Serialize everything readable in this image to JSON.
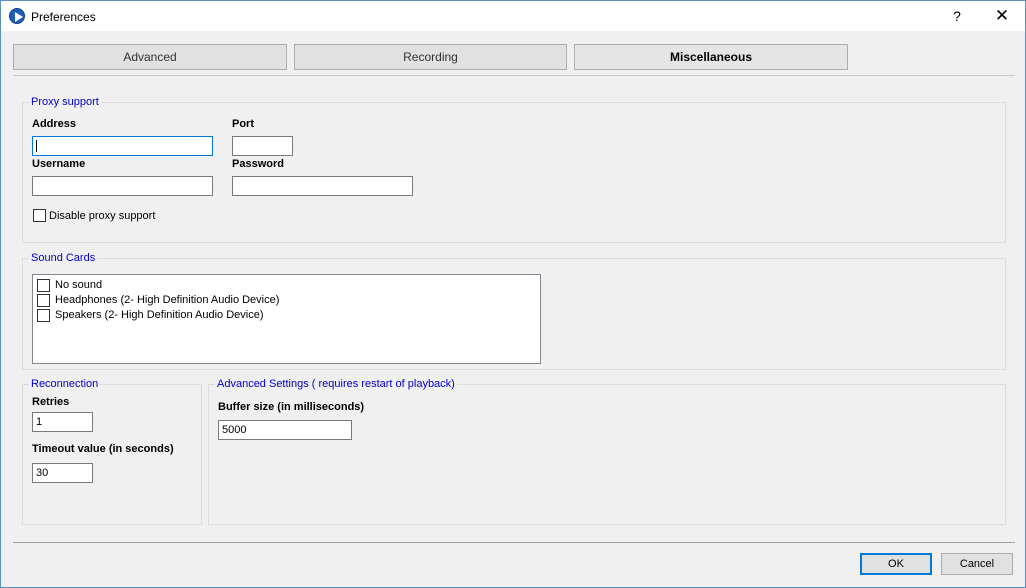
{
  "window": {
    "title": "Preferences",
    "help_label": "?",
    "close_label": "✕"
  },
  "tabs": [
    {
      "label": "Advanced"
    },
    {
      "label": "Recording"
    },
    {
      "label": "Miscellaneous"
    }
  ],
  "proxy": {
    "title": "Proxy support",
    "address_label": "Address",
    "address_value": "",
    "port_label": "Port",
    "port_value": "",
    "username_label": "Username",
    "username_value": "",
    "password_label": "Password",
    "password_value": "",
    "disable_label": "Disable proxy support"
  },
  "sound_cards": {
    "title": "Sound Cards",
    "items": [
      {
        "label": "No sound"
      },
      {
        "label": "Headphones (2- High Definition Audio Device)"
      },
      {
        "label": "Speakers (2- High Definition Audio Device)"
      }
    ]
  },
  "reconnection": {
    "title": "Reconnection",
    "retries_label": "Retries",
    "retries_value": "1",
    "timeout_label": "Timeout value (in seconds)",
    "timeout_value": "30"
  },
  "advanced_settings": {
    "title": "Advanced Settings ( requires restart of playback)",
    "buffer_label": "Buffer size (in milliseconds)",
    "buffer_value": "5000"
  },
  "buttons": {
    "ok": "OK",
    "cancel": "Cancel"
  },
  "colors": {
    "group_title": "#0000cc",
    "focus": "#0078d7",
    "icon": "#1d5fb8"
  }
}
